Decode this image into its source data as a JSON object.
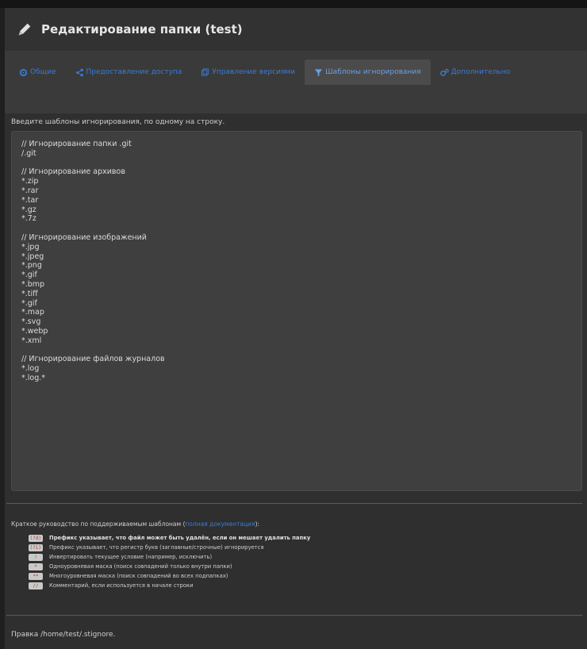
{
  "header": {
    "title": "Редактирование папки (test)",
    "icon": "pencil-icon"
  },
  "tabs": [
    {
      "label": "Общие",
      "icon": "gear-icon",
      "active": false
    },
    {
      "label": "Предоставление доступа",
      "icon": "share-icon",
      "active": false
    },
    {
      "label": "Управление версиями",
      "icon": "versions-icon",
      "active": false
    },
    {
      "label": "Шаблоны игнорирования",
      "icon": "filter-icon",
      "active": true
    },
    {
      "label": "Дополнительно",
      "icon": "gears-icon",
      "active": false
    }
  ],
  "hint": "Введите шаблоны игнорирования, по одному на строку.",
  "editor": {
    "lines": [
      "// Игнорирование папки .git",
      "/.git",
      "",
      "// Игнорирование архивов",
      "*.zip",
      "*.rar",
      "*.tar",
      "*.gz",
      "*.7z",
      "",
      "// Игнорирование изображений",
      "*.jpg",
      "*.jpeg",
      "*.png",
      "*.gif",
      "*.bmp",
      "*.tiff",
      "*.gif",
      "*.map",
      "*.svg",
      "*.webp",
      "*.xml",
      "",
      "// Игнорирование файлов журналов",
      "*.log",
      "*.log.*"
    ]
  },
  "guide": {
    "title": "Краткое руководство по поддерживаемым шаблонам (",
    "link": "полная документация",
    "title_end": "):",
    "rows": [
      {
        "badge": "(?d)",
        "text": "Префикс указывает, что файл может быть удалён, если он мешает удалить папку",
        "bold": true
      },
      {
        "badge": "(?i)",
        "text": "Префикс указывает, что регистр букв (заглавные/строчные) игнорируется",
        "bold": false
      },
      {
        "badge": "!",
        "text": "Инвертировать текущее условие (например, исключить)",
        "bold": false
      },
      {
        "badge": "*",
        "text": "Одноуровневая маска (поиск совпадений только внутри папки)",
        "bold": false
      },
      {
        "badge": "**",
        "text": "Многоуровневая маска (поиск совпадений во всех подпапках)",
        "bold": false
      },
      {
        "badge": "//",
        "text": "Комментарий, если используется в начале строки",
        "bold": false
      }
    ]
  },
  "footer": "Правка /home/test/.stignore.",
  "colors": {
    "accent": "#3a7bd5",
    "badge_text": "#c0392b",
    "background": "#2f2f2f"
  }
}
